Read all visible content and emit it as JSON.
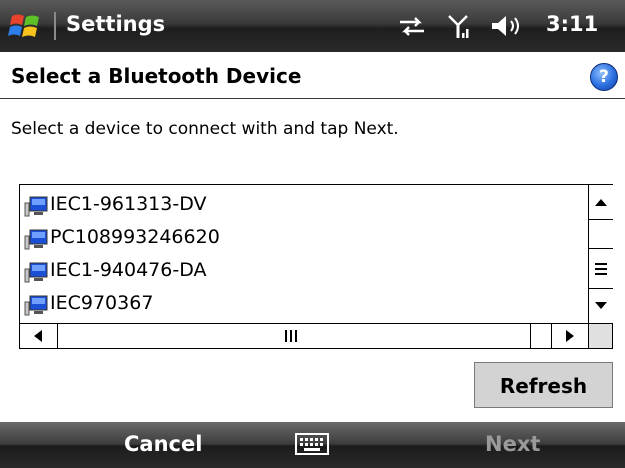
{
  "titlebar": {
    "title": "Settings",
    "clock": "3:11"
  },
  "icons": {
    "start": "windows-flag-icon",
    "connectivity": "data-connection-icon",
    "signal": "signal-strength-icon",
    "volume": "volume-icon",
    "help": "help-icon",
    "device": "computer-device-icon",
    "keyboard": "keyboard-icon"
  },
  "page": {
    "title": "Select a Bluetooth Device",
    "help_glyph": "?",
    "instructions": "Select a device to connect with and tap Next."
  },
  "devices": [
    {
      "name": "IEC1-961313-DV"
    },
    {
      "name": "PC108993246620"
    },
    {
      "name": "IEC1-940476-DA"
    },
    {
      "name": "IEC970367"
    }
  ],
  "buttons": {
    "refresh": "Refresh"
  },
  "softkeys": {
    "left": "Cancel",
    "right": "Next"
  },
  "colors": {
    "help_blue": "#2a6fe0",
    "device_blue": "#1b4fd6",
    "disabled_text": "#9a9a9a"
  }
}
